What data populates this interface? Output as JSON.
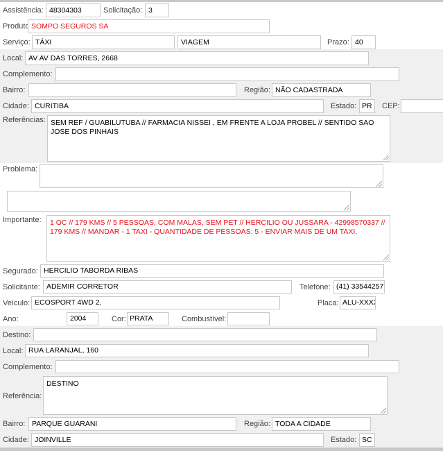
{
  "assistencia": {
    "label": "Assistência:",
    "value": "48304303"
  },
  "solicitacao": {
    "label": "Solicitação:",
    "value": "3"
  },
  "produto": {
    "label": "Produto:",
    "value": "SOMPO SEGUROS SA",
    "color": "#e8101a"
  },
  "servico": {
    "label": "Serviço:",
    "value": "TÁXI",
    "value2": "VIAGEM"
  },
  "prazo": {
    "label": "Prazo:",
    "value": "40"
  },
  "origem": {
    "local": {
      "label": "Local:",
      "value": "AV AV DAS TORRES, 2668"
    },
    "complemento": {
      "label": "Complemento:",
      "value": ""
    },
    "bairro": {
      "label": "Bairro:",
      "value": ""
    },
    "regiao": {
      "label": "Região:",
      "value": "NÃO CADASTRADA"
    },
    "cidade": {
      "label": "Cidade:",
      "value": "CURITIBA"
    },
    "estado": {
      "label": "Estado:",
      "value": "PR"
    },
    "cep": {
      "label": "CEP:",
      "value": ""
    },
    "referencias": {
      "label": "Referências:",
      "value": "SEM REF / GUABILUTUBA // FARMACIA NISSEI , EM FRENTE A LOJA PROBEL // SENTIDO SAO JOSE DOS PINHAIS"
    }
  },
  "problema": {
    "label": "Problema:",
    "value": "",
    "extra": ""
  },
  "importante": {
    "label": "Importante:",
    "value": "1 OC // 179 KMS // 5 PESSOAS, COM MALAS, SEM PET // HERCILIO OU JUSSARA - 42998570337 // 179 KMS // MANDAR - 1 TAXI - QUANTIDADE DE PESSOAS: 5 - ENVIAR MAIS DE UM TAXI."
  },
  "segurado": {
    "label": "Segurado:",
    "value": "HERCILIO TABORDA RIBAS"
  },
  "solicitante": {
    "label": "Solicitante:",
    "value": "ADEMIR CORRETOR"
  },
  "telefone": {
    "label": "Telefone:",
    "value": "(41) 33544257"
  },
  "veiculo": {
    "label": "Veículo:",
    "value": "ECOSPORT 4WD 2."
  },
  "placa": {
    "label": "Placa:",
    "value": "ALU-XXXX"
  },
  "ano": {
    "label": "Ano:",
    "value": "2004"
  },
  "cor": {
    "label": "Cor:",
    "value": "PRATA"
  },
  "combustivel": {
    "label": "Combustível:",
    "value": ""
  },
  "destino": {
    "destino": {
      "label": "Destino:",
      "value": ""
    },
    "local": {
      "label": "Local:",
      "value": "RUA LARANJAL, 160"
    },
    "complemento": {
      "label": "Complemento:",
      "value": ""
    },
    "referencia": {
      "label": "Referência:",
      "value": "DESTINO"
    },
    "bairro": {
      "label": "Bairro:",
      "value": "PARQUE GUARANI"
    },
    "regiao": {
      "label": "Região:",
      "value": "TODA A CIDADE"
    },
    "cidade": {
      "label": "Cidade:",
      "value": "JOINVILLE"
    },
    "estado": {
      "label": "Estado:",
      "value": "SC"
    }
  }
}
